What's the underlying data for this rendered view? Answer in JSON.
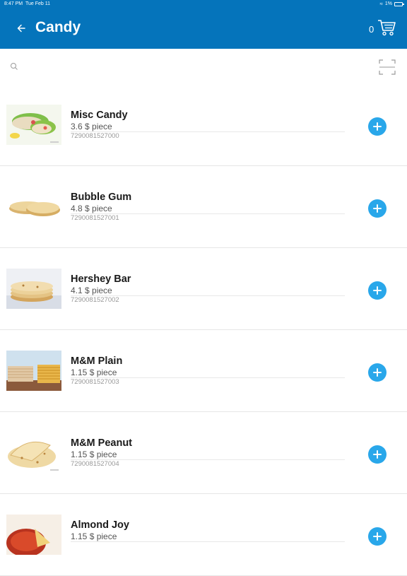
{
  "status_bar": {
    "time": "8:47 PM",
    "date": "Tue Feb 11",
    "battery": "1%"
  },
  "header": {
    "title": "Candy",
    "cart_count": "0"
  },
  "search": {
    "placeholder": ""
  },
  "products": [
    {
      "name": "Misc Candy",
      "price": "3.6 $ piece",
      "barcode": "7290081527000",
      "thumb": "wraps"
    },
    {
      "name": "Bubble Gum",
      "price": "4.8 $ piece",
      "barcode": "7290081527001",
      "thumb": "tortillas-flat"
    },
    {
      "name": "Hershey Bar",
      "price": "4.1 $ piece",
      "barcode": "7290081527002",
      "thumb": "tortilla-stack"
    },
    {
      "name": "M&M Plain",
      "price": "1.15 $ piece",
      "barcode": "7290081527003",
      "thumb": "tortilla-stacks"
    },
    {
      "name": "M&M Peanut",
      "price": "1.15 $ piece",
      "barcode": "7290081527004",
      "thumb": "tortilla-folded"
    },
    {
      "name": "Almond Joy",
      "price": "1.15 $ piece",
      "barcode": "",
      "thumb": "salsa"
    }
  ],
  "colors": {
    "primary": "#0574bb",
    "add_button": "#29a7ea"
  }
}
